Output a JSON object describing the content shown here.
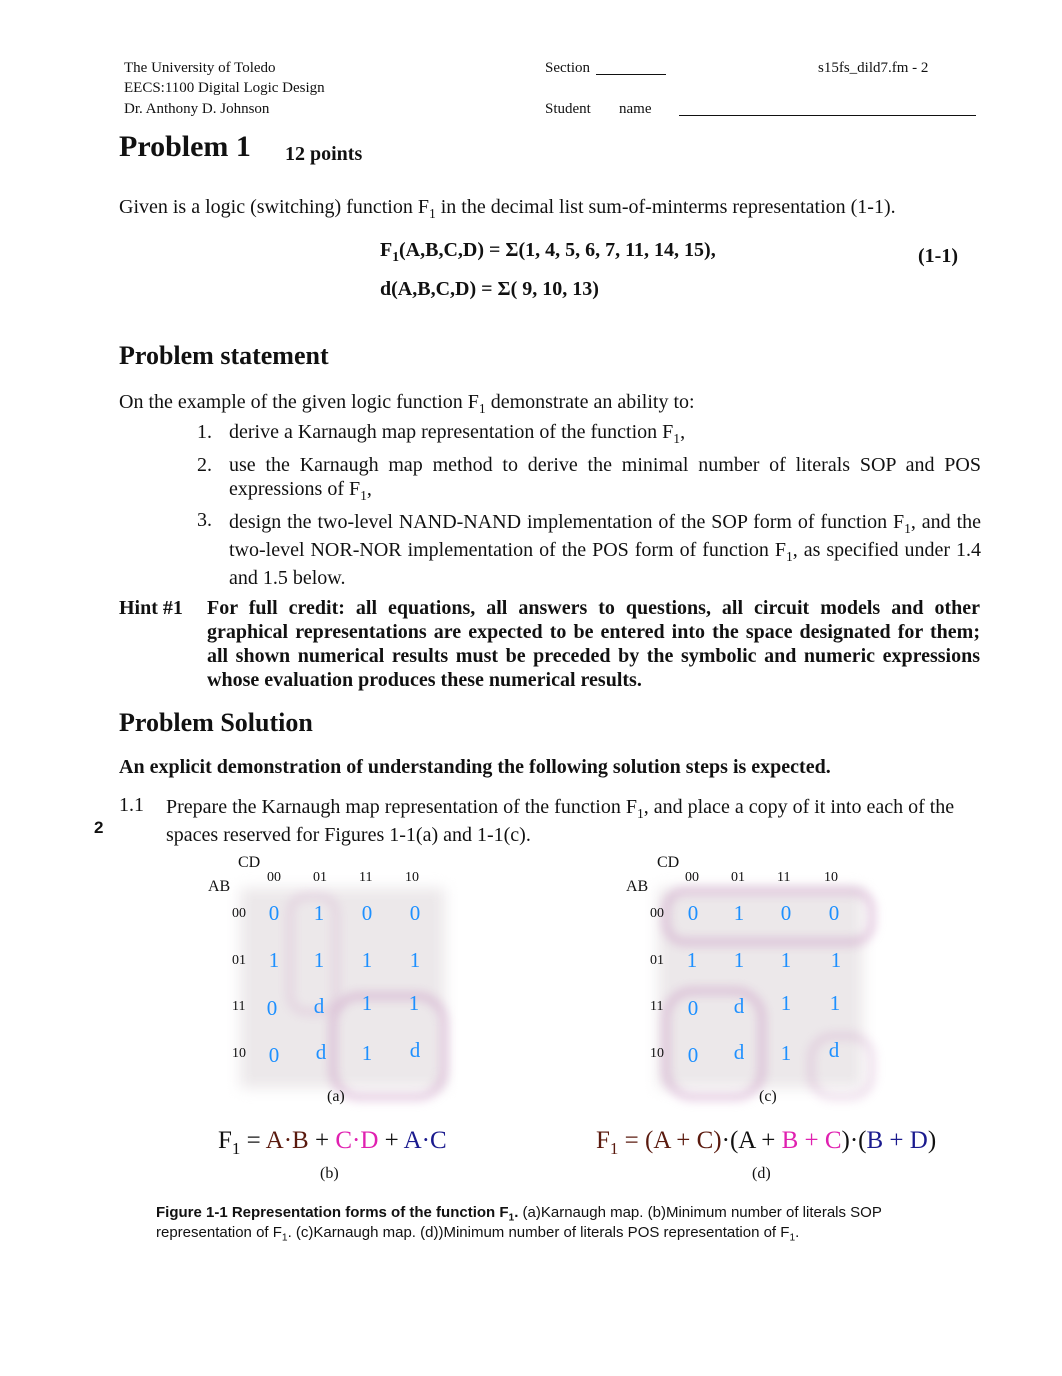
{
  "header": {
    "university": "The University of Toledo",
    "course": "EECS:1100 Digital Logic Design",
    "instructor": "Dr. Anthony D. Johnson",
    "section_label": "Section",
    "file_id": "s15fs_dild7.fm - 2",
    "student_label": "Student",
    "name_label": "name"
  },
  "problem": {
    "title": "Problem 1",
    "points": "12 points",
    "intro_before": "Given is a logic (switching) function F",
    "intro_sub": "1",
    "intro_after": " in the decimal list sum-of-minterms representation (1-1).",
    "eq1_lhs": "F",
    "eq1_sub": "1",
    "eq1_rest": "(A,B,C,D)  = Σ(1, 4, 5, 6, 7, 11, 14, 15),",
    "eq2": "d(A,B,C,D)  = Σ( 9, 10, 13)",
    "eq_number": "(1-1)"
  },
  "statement": {
    "heading": "Problem statement",
    "intro_before": "On the example of the given logic function F",
    "intro_sub": "1",
    "intro_after": " demonstrate an ability to:",
    "items": [
      {
        "num": "1.",
        "before": "derive a Karnaugh map representation of the function F",
        "sub": "1",
        "after": ","
      },
      {
        "num": "2.",
        "before": "use the Karnaugh map method to derive the minimal number of literals SOP and POS expressions of F",
        "sub": "1",
        "after": ","
      },
      {
        "num": "3.",
        "before": "design the two-level NAND-NAND implementation of the SOP form of function F",
        "sub": "1",
        "mid": ", and the two-level NOR-NOR implementation of the POS form of function F",
        "sub2": "1",
        "after": ", as specified under 1.4 and 1.5 below."
      }
    ],
    "hint_label": "Hint #1",
    "hint_text": "For full credit: all equations, all answers to questions, all circuit models and other graphical representations are expected to be entered into the space designated for them; all shown numerical results must be preceded by the symbolic and numeric expressions whose evaluation produces these numerical results."
  },
  "solution": {
    "heading": "Problem Solution",
    "lead": "An explicit demonstration of understanding the following solution steps is expected.",
    "step_num": "1.1",
    "step_before": "Prepare the Karnaugh map representation of the function F",
    "step_sub": "1",
    "step_after": ", and place a copy of it into each of the spaces reserved for Figures 1-1(a) and 1-1(c).",
    "margin_points": "2"
  },
  "kmaps": [
    {
      "caption": "(a)",
      "col_var": "CD",
      "row_var": "AB",
      "col_labels": [
        "00",
        "01",
        "11",
        "10"
      ],
      "row_labels": [
        "00",
        "01",
        "11",
        "10"
      ],
      "cells": [
        [
          "0",
          "1",
          "0",
          "0"
        ],
        [
          "1",
          "1",
          "1",
          "1"
        ],
        [
          "0",
          "d",
          "1",
          "1"
        ],
        [
          "0",
          "d",
          "1",
          "d"
        ]
      ]
    },
    {
      "caption": "(c)",
      "col_var": "CD",
      "row_var": "AB",
      "col_labels": [
        "00",
        "01",
        "11",
        "10"
      ],
      "row_labels": [
        "00",
        "01",
        "11",
        "10"
      ],
      "cells": [
        [
          "0",
          "1",
          "0",
          "0"
        ],
        [
          "1",
          "1",
          "1",
          "1"
        ],
        [
          "0",
          "d",
          "1",
          "1"
        ],
        [
          "0",
          "d",
          "1",
          "d"
        ]
      ]
    }
  ],
  "expressions": {
    "sop": {
      "lhs": "F",
      "sub": "1",
      "eq": " = ",
      "t1": "A·B",
      "p1": " + ",
      "t2": "C·D",
      "p2": " + ",
      "t3": "A·C",
      "caption": "(b)"
    },
    "pos": {
      "lhs": "F",
      "sub": "1",
      "eq": " = ",
      "f1": "(A + C)",
      "dot1": "·",
      "f2a": "(A + ",
      "f2b": "B + C",
      "f2c": ")",
      "dot2": "·",
      "f3a": "(",
      "f3b": "B + D",
      "f3c": ")",
      "caption": "(d)"
    },
    "colors": {
      "term1": "#5a1a0e",
      "term2": "#e020b0",
      "term3": "#1a1a8e",
      "cell": "#1e90ff"
    }
  },
  "figure_caption": {
    "bold_before": "Figure 1-1 Representation forms of the function F",
    "bold_sub": "1",
    "bold_after": ".",
    "text1": " (a)Karnaugh map. (b)Minimum number of literals SOP representation of F",
    "sub1": "1",
    "text2": ". (c)Karnaugh map. (d))Minimum number of literals POS representation of F",
    "sub2": "1",
    "text3": "."
  }
}
